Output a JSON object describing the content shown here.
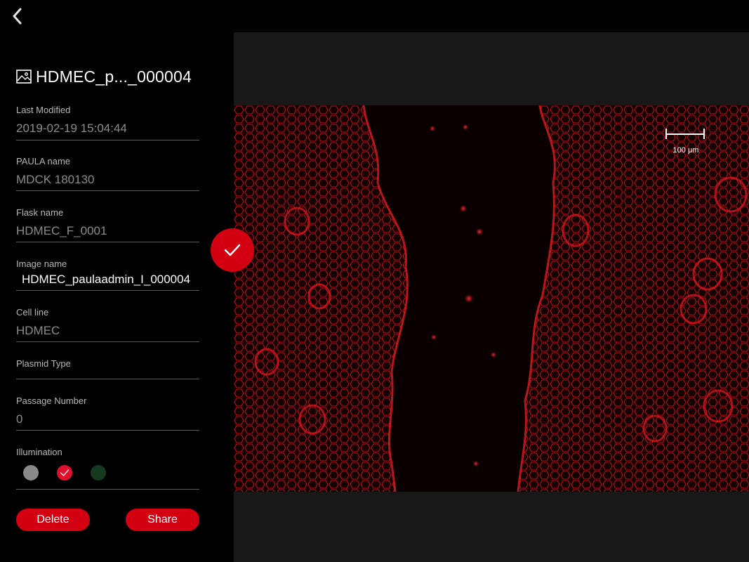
{
  "header": {
    "back_icon": "chevron-left-icon"
  },
  "sidebar": {
    "title": "HDMEC_p..._000004",
    "title_icon": "image-icon",
    "fields": [
      {
        "label": "Last Modified",
        "value": "2019-02-19 15:04:44"
      },
      {
        "label": "PAULA name",
        "value": "MDCK 180130"
      },
      {
        "label": "Flask name",
        "value": "HDMEC_F_0001"
      },
      {
        "label": "Image name",
        "value": "HDMEC_paulaadmin_I_000004"
      },
      {
        "label": "Cell line",
        "value": "HDMEC"
      },
      {
        "label": "Plasmid Type",
        "value": ""
      },
      {
        "label": "Passage Number",
        "value": "0"
      }
    ],
    "illumination": {
      "label": "Illumination",
      "options": [
        {
          "color": "#8a8a8a",
          "selected": false
        },
        {
          "color": "#e0102c",
          "selected": true
        },
        {
          "color": "#163a1f",
          "selected": false
        }
      ]
    },
    "buttons": {
      "delete_label": "Delete",
      "share_label": "Share"
    }
  },
  "viewer": {
    "scale_label": "100 μm",
    "colors": {
      "accent": "#d30011",
      "background": "#181818",
      "cell": "#c8141e"
    }
  },
  "confirm_icon": "checkmark-icon"
}
